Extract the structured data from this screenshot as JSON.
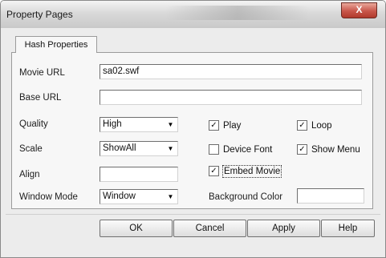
{
  "window": {
    "title": "Property Pages",
    "close_glyph": "X"
  },
  "tabs": [
    {
      "label": "Hash Properties"
    }
  ],
  "labels": {
    "movie_url": "Movie URL",
    "base_url": "Base URL",
    "quality": "Quality",
    "scale": "Scale",
    "align": "Align",
    "window_mode": "Window Mode",
    "background_color": "Background Color"
  },
  "fields": {
    "movie_url": "sa02.swf",
    "base_url": "",
    "align": "",
    "background_color": ""
  },
  "combos": {
    "quality": "High",
    "scale": "ShowAll",
    "window_mode": "Window",
    "arrow_glyph": "▼"
  },
  "checkboxes": {
    "play": {
      "label": "Play",
      "checked": true
    },
    "loop": {
      "label": "Loop",
      "checked": true
    },
    "device_font": {
      "label": "Device Font",
      "checked": false
    },
    "show_menu": {
      "label": "Show Menu",
      "checked": true
    },
    "embed_movie": {
      "label": "Embed Movie",
      "checked": true
    },
    "check_glyph": "✓"
  },
  "buttons": {
    "ok": "OK",
    "cancel": "Cancel",
    "apply": "Apply",
    "help": "Help"
  }
}
